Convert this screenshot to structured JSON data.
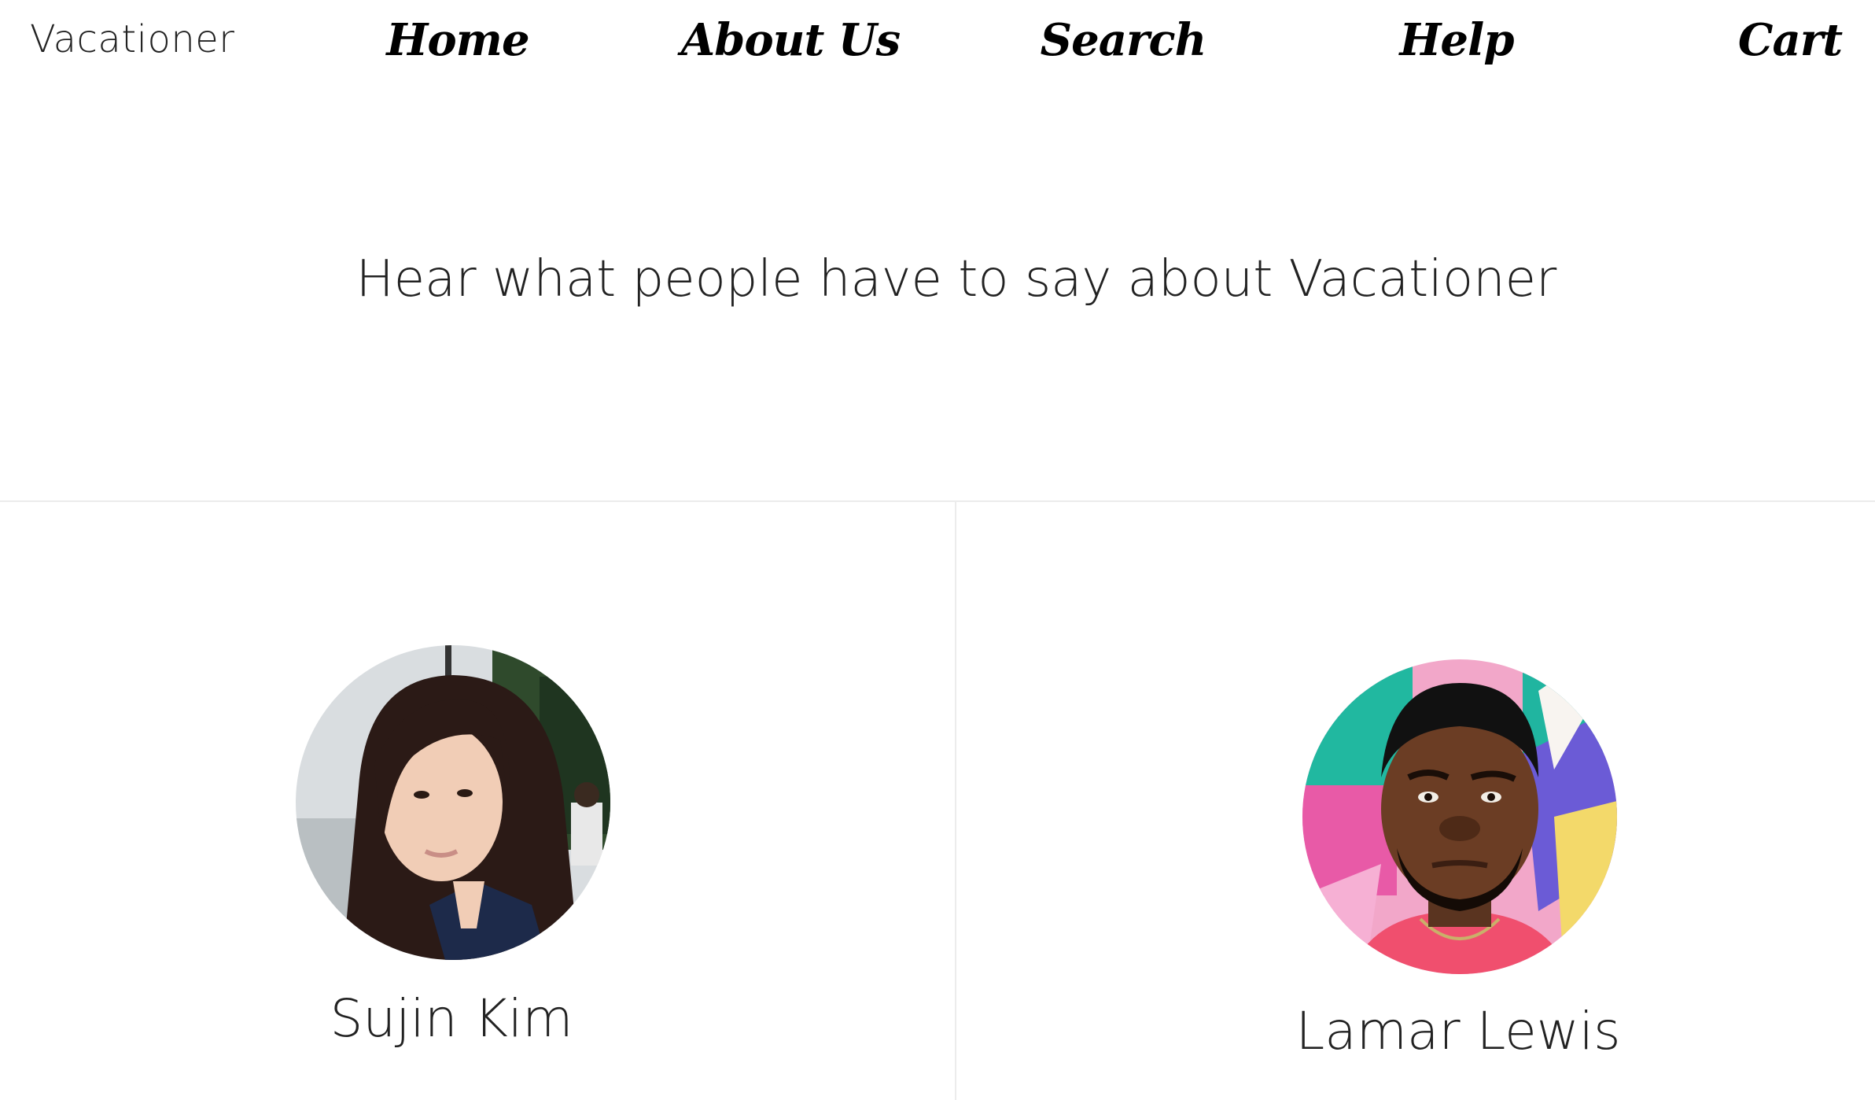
{
  "brand": "Vacationer",
  "nav": {
    "home": "Home",
    "about": "About Us",
    "search": "Search",
    "help": "Help",
    "cart": "Cart"
  },
  "heading": "Hear what people have to say about Vacationer",
  "testimonials": [
    {
      "name": "Sujin Kim",
      "avatar": "woman-portrait-photo"
    },
    {
      "name": "Lamar Lewis",
      "avatar": "man-portrait-photo"
    }
  ]
}
